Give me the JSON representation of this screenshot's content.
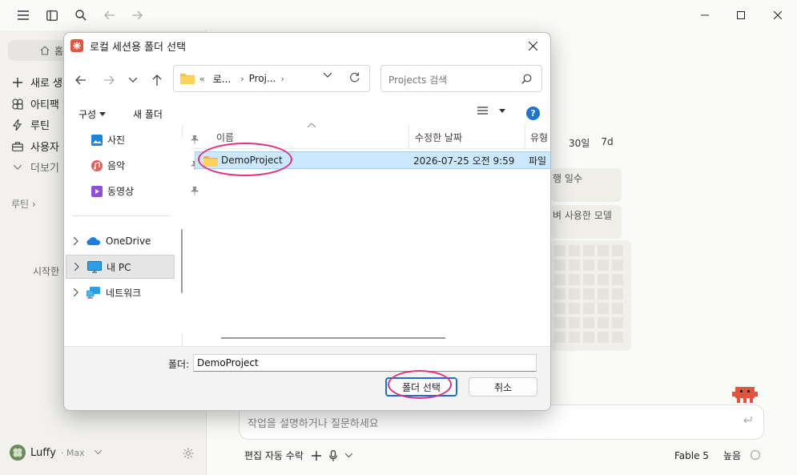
{
  "app": {
    "sidebar": {
      "home_label": "홈",
      "items": [
        {
          "label": "새로 생",
          "icon": "plus-icon"
        },
        {
          "label": "아티팩",
          "icon": "artifact-icon"
        },
        {
          "label": "루틴",
          "icon": "bolt-icon"
        },
        {
          "label": "사용자",
          "icon": "briefcase-icon"
        },
        {
          "label": "더보기",
          "icon": "chevron-down-icon"
        }
      ],
      "section_label": "루틴 ›",
      "empty_text": "시작한",
      "user_name": "Luffy",
      "plan": "· Max"
    },
    "main": {
      "range_tabs": [
        "30일",
        "7d"
      ],
      "stat_cards": [
        "행 일수",
        "벼 사용한 모델"
      ],
      "prompt_placeholder": "작업을 설명하거나 질문하세요",
      "bottom_left": "편집 자동 수락",
      "model": "Fable 5",
      "effort": "높음"
    },
    "colors": {
      "accent": "#e0307e",
      "primary_blue": "#1f6fc9",
      "selection": "#cce8ff"
    }
  },
  "dialog": {
    "title": "로컬 세션용 폴더 선택",
    "address": {
      "prefix": "«",
      "crumbs": [
        "로...",
        "Proj..."
      ]
    },
    "search_placeholder": "Projects 검색",
    "toolbar": {
      "organize": "구성",
      "new_folder": "새 폴더"
    },
    "quick_access": [
      {
        "label": "사진",
        "icon": "pictures-icon"
      },
      {
        "label": "음악",
        "icon": "music-icon"
      },
      {
        "label": "동영상",
        "icon": "video-icon"
      }
    ],
    "tree": [
      {
        "label": "OneDrive",
        "icon": "cloud-icon"
      },
      {
        "label": "내 PC",
        "icon": "pc-icon"
      },
      {
        "label": "네트워크",
        "icon": "network-icon"
      }
    ],
    "columns": {
      "name": "이름",
      "modified": "수정한 날짜",
      "type": "유형"
    },
    "files": [
      {
        "name": "DemoProject",
        "modified": "2026-07-25 오전 9:59",
        "type": "파일"
      }
    ],
    "folder_label": "폴더:",
    "folder_value": "DemoProject",
    "select_button": "폴더 선택",
    "cancel_button": "취소"
  }
}
